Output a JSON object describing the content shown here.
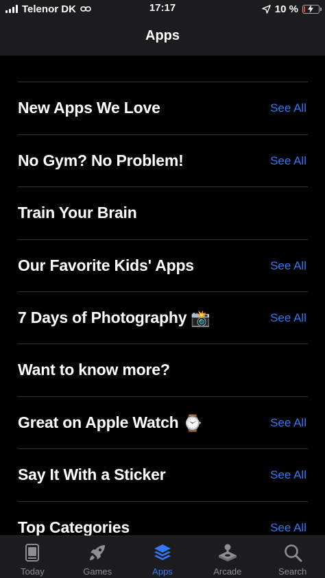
{
  "status_bar": {
    "carrier": "Telenor DK",
    "time": "17:17",
    "battery": "10 %",
    "battery_level": 0.1,
    "battery_color": "#ff3b30"
  },
  "nav": {
    "title": "Apps"
  },
  "accent_color": "#3478f6",
  "sections": [
    {
      "title": "New Apps We Love",
      "action": "See All"
    },
    {
      "title": "No Gym? No Problem!",
      "action": "See All"
    },
    {
      "title": "Train Your Brain",
      "action": ""
    },
    {
      "title": "Our Favorite Kids' Apps",
      "action": "See All"
    },
    {
      "title": "7 Days of Photography",
      "emoji": "📸",
      "action": "See All"
    },
    {
      "title": "Want to know more?",
      "action": ""
    },
    {
      "title": "Great on Apple Watch",
      "emoji": "⌚",
      "action": "See All"
    },
    {
      "title": "Say It With a Sticker",
      "action": "See All"
    },
    {
      "title": "Top Categories",
      "action": "See All"
    }
  ],
  "tabs": [
    {
      "label": "Today",
      "icon": "today-icon",
      "active": false
    },
    {
      "label": "Games",
      "icon": "rocket-icon",
      "active": false
    },
    {
      "label": "Apps",
      "icon": "layers-icon",
      "active": true
    },
    {
      "label": "Arcade",
      "icon": "joystick-icon",
      "active": false
    },
    {
      "label": "Search",
      "icon": "search-icon",
      "active": false
    }
  ]
}
